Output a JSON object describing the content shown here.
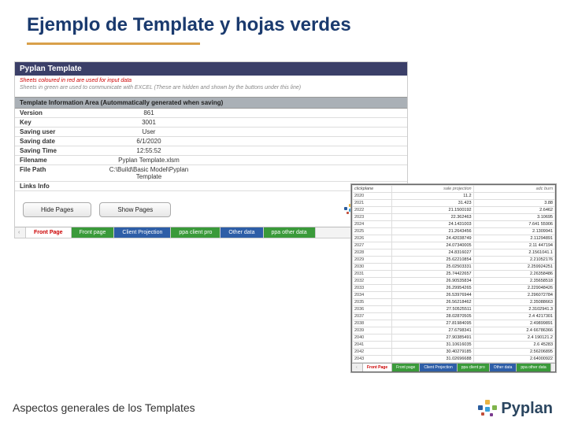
{
  "slide": {
    "title": "Ejemplo de Template y hojas verdes",
    "footer": "Aspectos generales de los Templates",
    "logo_text": "Pyplan"
  },
  "template_panel": {
    "header": "Pyplan Template",
    "note_red": "Sheets coloured in red are used for input data",
    "note_gray": "Sheets in green are used to communicate with EXCEL (These are hidden and shown by the buttons under this line)",
    "info_header": "Template Information Area (Autommatically generated when saving)",
    "rows": [
      {
        "key": "Version",
        "val": "861"
      },
      {
        "key": "Key",
        "val": "3001"
      },
      {
        "key": "Saving user",
        "val": "User"
      },
      {
        "key": "Saving date",
        "val": "6/1/2020"
      },
      {
        "key": "Saving Time",
        "val": "12:55:52"
      },
      {
        "key": "Filename",
        "val": "Pyplan Template.xlsm"
      },
      {
        "key": "File Path",
        "val": "C:\\Build\\Basic Model\\Pyplan Template"
      },
      {
        "key": "Links Info",
        "val": ""
      }
    ],
    "buttons": {
      "hide": "Hide Pages",
      "show": "Show Pages"
    },
    "tabs": [
      {
        "label": "Front Page",
        "style": "red"
      },
      {
        "label": "Front page",
        "style": "green"
      },
      {
        "label": "Client Projection",
        "style": "blue"
      },
      {
        "label": "ppa client pro",
        "style": "green"
      },
      {
        "label": "Other data",
        "style": "blue"
      },
      {
        "label": "ppa other data",
        "style": "green"
      }
    ]
  },
  "sheet": {
    "headers": [
      "clickplane",
      "sale projection",
      "adc burn"
    ],
    "rows": [
      [
        "2020",
        "11.2",
        ""
      ],
      [
        "2021",
        "31.423",
        "3.88"
      ],
      [
        "2022",
        "21.1500192",
        "2.6462"
      ],
      [
        "2023",
        "22.362463",
        "3.10695"
      ],
      [
        "2024",
        "24.1431003",
        "7.641 55906"
      ],
      [
        "2025",
        "21.2643456",
        "2.1309941"
      ],
      [
        "2026",
        "24.42038749",
        "2.11294891"
      ],
      [
        "2027",
        "24.07340005",
        "2.11 447194"
      ],
      [
        "2028",
        "24.8316027",
        "2.1561041.1"
      ],
      [
        "2029",
        "25.62210854",
        "2.21052176"
      ],
      [
        "2030",
        "25.02503331",
        "2.259924251"
      ],
      [
        "2031",
        "25.74422657",
        "2.26358486"
      ],
      [
        "2032",
        "26.90535834",
        "2.35658518"
      ],
      [
        "2033",
        "26.29954265",
        "2.229048426"
      ],
      [
        "2034",
        "26.53976944",
        "2.296072784"
      ],
      [
        "2035",
        "26.56218462",
        "2.35088663"
      ],
      [
        "2036",
        "27.50525511",
        "2.3102941.3"
      ],
      [
        "2037",
        "28.02870505",
        "2.4 4217301"
      ],
      [
        "2038",
        "27.81984095",
        "2.49899891"
      ],
      [
        "2039",
        "27.6798341",
        "2.4 66786366"
      ],
      [
        "2040",
        "27.90385491",
        "2.4 190121.2"
      ],
      [
        "2041",
        "31.10616035",
        "2.6 45283"
      ],
      [
        "2042",
        "30.40279185",
        "2.56206895"
      ],
      [
        "2043",
        "31.02696688",
        "2.64000922"
      ]
    ],
    "tabs": [
      {
        "label": "Front Page",
        "style": "red"
      },
      {
        "label": "Front page",
        "style": "green"
      },
      {
        "label": "Client Projection",
        "style": "blue"
      },
      {
        "label": "ppa client pro",
        "style": "green"
      },
      {
        "label": "Other data",
        "style": "blue"
      },
      {
        "label": "ppa other data",
        "style": "green"
      }
    ]
  }
}
